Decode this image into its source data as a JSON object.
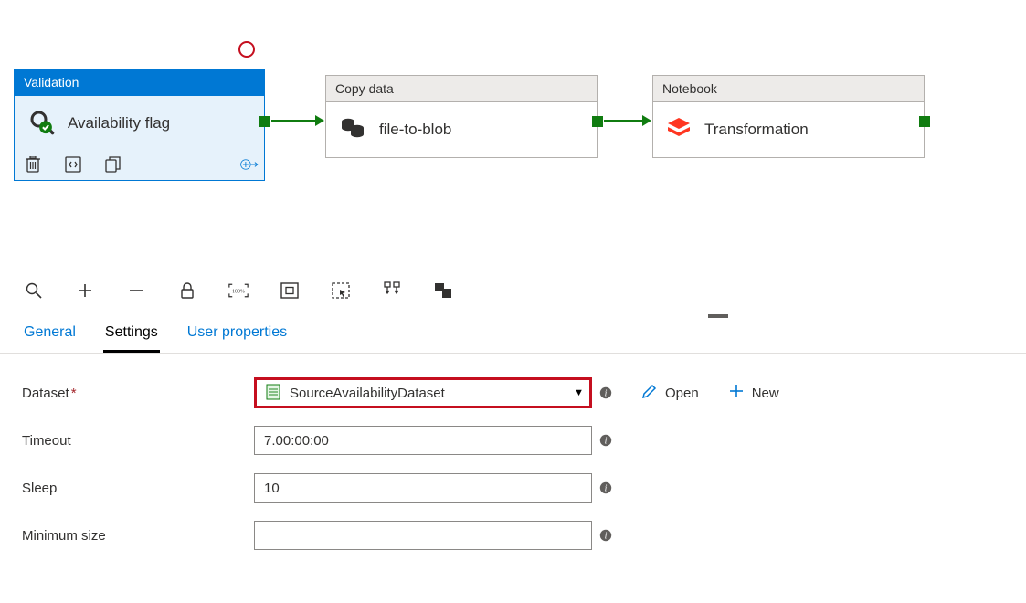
{
  "activities": {
    "validation": {
      "type_label": "Validation",
      "name": "Availability flag"
    },
    "copy": {
      "type_label": "Copy data",
      "name": "file-to-blob"
    },
    "notebook": {
      "type_label": "Notebook",
      "name": "Transformation"
    }
  },
  "tabs": {
    "general": "General",
    "settings": "Settings",
    "user_properties": "User properties"
  },
  "settings_form": {
    "dataset_label": "Dataset",
    "dataset_value": "SourceAvailabilityDataset",
    "open_label": "Open",
    "new_label": "New",
    "timeout_label": "Timeout",
    "timeout_value": "7.00:00:00",
    "sleep_label": "Sleep",
    "sleep_value": "10",
    "minsize_label": "Minimum size",
    "minsize_value": ""
  }
}
